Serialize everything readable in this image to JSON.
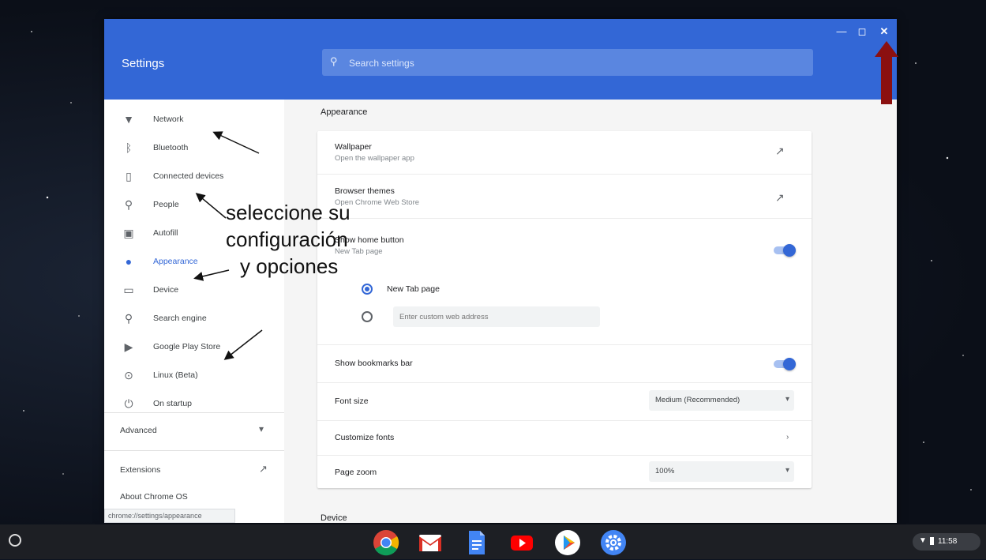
{
  "window": {
    "title": "Settings",
    "search_placeholder": "Search settings",
    "controls": {
      "minimize": "—",
      "maximize": "◻",
      "close": "✕"
    }
  },
  "sidebar": {
    "items": [
      {
        "label": "Network",
        "icon": "wifi-icon",
        "glyph": "▼",
        "active": false
      },
      {
        "label": "Bluetooth",
        "icon": "bluetooth-icon",
        "glyph": "ᛒ",
        "active": false
      },
      {
        "label": "Connected devices",
        "icon": "phone-icon",
        "glyph": "▯",
        "active": false
      },
      {
        "label": "People",
        "icon": "person-icon",
        "glyph": "⚲",
        "active": false
      },
      {
        "label": "Autofill",
        "icon": "autofill-icon",
        "glyph": "▣",
        "active": false
      },
      {
        "label": "Appearance",
        "icon": "palette-icon",
        "glyph": "●",
        "active": true
      },
      {
        "label": "Device",
        "icon": "laptop-icon",
        "glyph": "▭",
        "active": false
      },
      {
        "label": "Search engine",
        "icon": "search-icon",
        "glyph": "⚲",
        "active": false
      },
      {
        "label": "Google Play Store",
        "icon": "play-store-icon",
        "glyph": "▶",
        "active": false
      },
      {
        "label": "Linux (Beta)",
        "icon": "linux-icon",
        "glyph": "⊙",
        "active": false
      },
      {
        "label": "On startup",
        "icon": "power-icon",
        "glyph": "⏻",
        "active": false
      }
    ],
    "advanced": "Advanced",
    "extensions": "Extensions",
    "about": "About Chrome OS",
    "status_url": "chrome://settings/appearance"
  },
  "main": {
    "section_title": "Appearance",
    "wallpaper": {
      "title": "Wallpaper",
      "subtitle": "Open the wallpaper app"
    },
    "browser_themes": {
      "title": "Browser themes",
      "subtitle": "Open Chrome Web Store"
    },
    "home_button": {
      "title": "Show home button",
      "subtitle": "New Tab page",
      "enabled": true
    },
    "radio_new_tab": "New Tab page",
    "custom_url_placeholder": "Enter custom web address",
    "bookmarks_bar": {
      "title": "Show bookmarks bar",
      "enabled": true
    },
    "font_size": {
      "title": "Font size",
      "value": "Medium (Recommended)"
    },
    "customize_fonts": {
      "title": "Customize fonts"
    },
    "page_zoom": {
      "title": "Page zoom",
      "value": "100%"
    },
    "next_section_title": "Device"
  },
  "annotation": {
    "line1": "seleccione su",
    "line2": "configuración",
    "line3": "y opciones",
    "arrow_color": "#111111",
    "close_arrow_color": "#8b1010"
  },
  "shelf": {
    "apps": [
      "chrome-icon",
      "gmail-icon",
      "docs-icon",
      "youtube-icon",
      "play-store-icon",
      "settings-icon"
    ],
    "time": "11:58"
  }
}
